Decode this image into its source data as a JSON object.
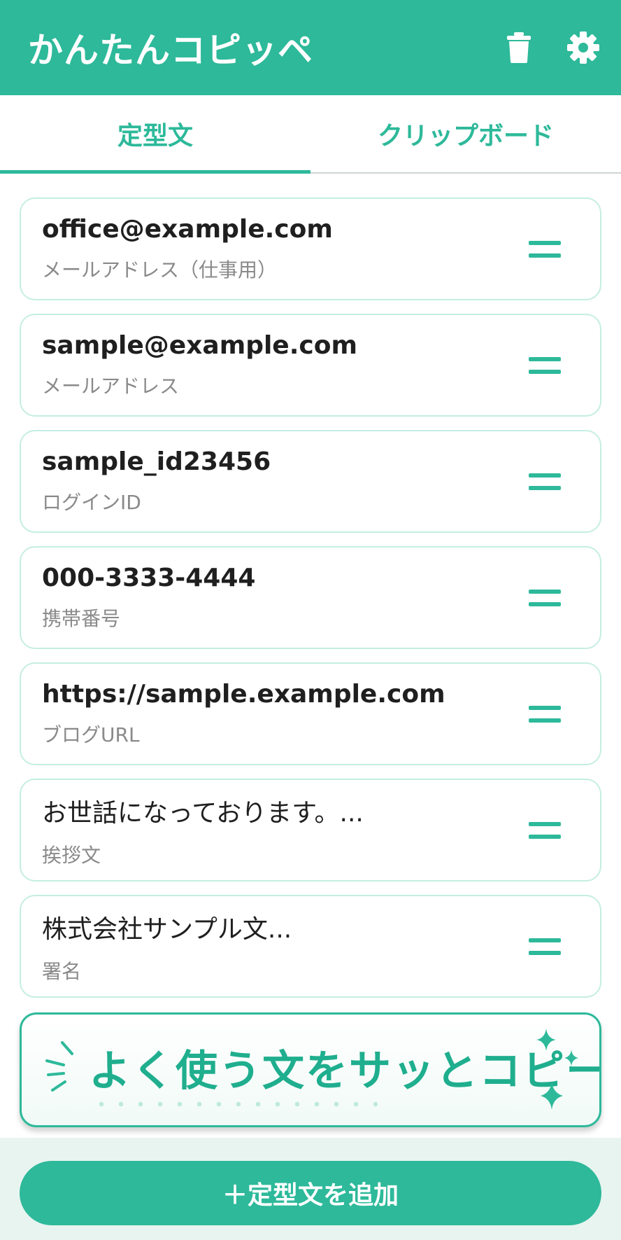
{
  "app": {
    "title": "かんたんコピッペ"
  },
  "toolbar": {
    "delete_icon": "trash-icon",
    "settings_icon": "gear-icon"
  },
  "tabs": [
    {
      "label": "定型文",
      "active": true
    },
    {
      "label": "クリップボード",
      "active": false
    }
  ],
  "snippets": [
    {
      "value": "office@example.com",
      "label": "メールアドレス（仕事用）"
    },
    {
      "value": "sample@example.com",
      "label": "メールアドレス"
    },
    {
      "value": "sample_id23456",
      "label": "ログインID"
    },
    {
      "value": "000-3333-4444",
      "label": "携帯番号"
    },
    {
      "value": "https://sample.example.com",
      "label": "ブログURL"
    },
    {
      "value": "お世話になっております。...",
      "label": "挨拶文"
    },
    {
      "value": "株式会社サンプル文...",
      "label": "署名"
    }
  ],
  "promo": {
    "headline": "よく使う文をサッとコピー"
  },
  "add_button": {
    "label": "＋定型文を追加"
  },
  "colors": {
    "accent": "#2db99a",
    "card_border": "#c5eee3",
    "bottom_bg": "#e8f4f0"
  }
}
